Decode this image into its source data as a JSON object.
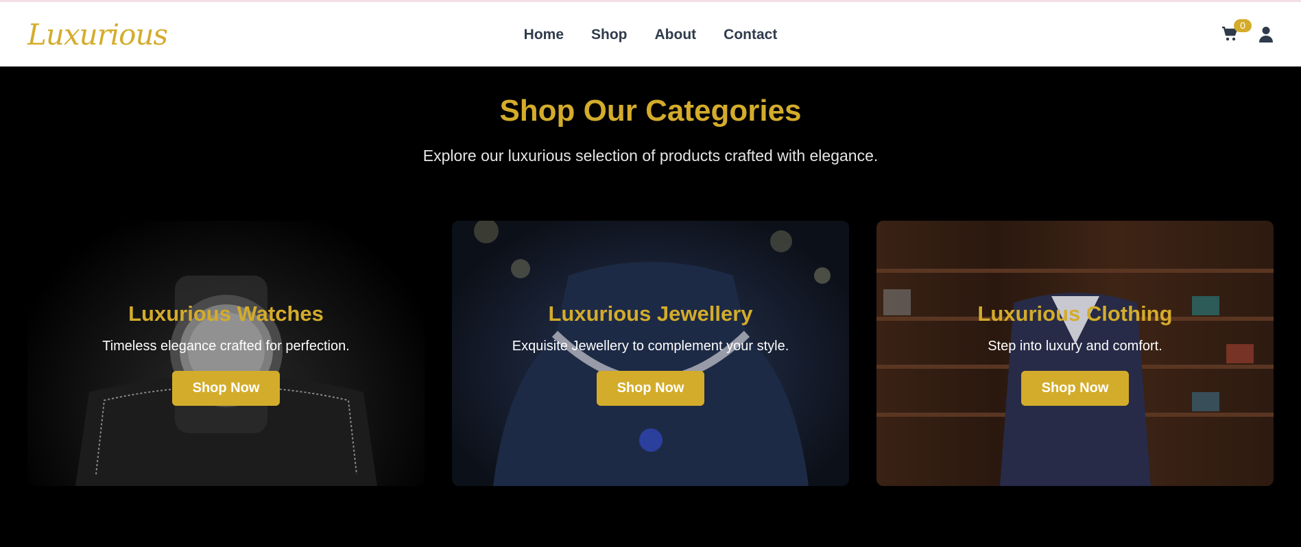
{
  "header": {
    "logo": "Luxurious",
    "nav": [
      "Home",
      "Shop",
      "About",
      "Contact"
    ],
    "cart_count": "0"
  },
  "main": {
    "title": "Shop Our Categories",
    "subtitle": "Explore our luxurious selection of products crafted with elegance."
  },
  "categories": [
    {
      "title": "Luxurious Watches",
      "description": "Timeless elegance crafted for perfection.",
      "button": "Shop Now"
    },
    {
      "title": "Luxurious Jewellery",
      "description": "Exquisite Jewellery to complement your style.",
      "button": "Shop Now"
    },
    {
      "title": "Luxurious Clothing",
      "description": "Step into luxury and comfort.",
      "button": "Shop Now"
    }
  ],
  "colors": {
    "accent": "#d4ac2b",
    "nav_text": "#2f3b4b",
    "background": "#000000"
  }
}
